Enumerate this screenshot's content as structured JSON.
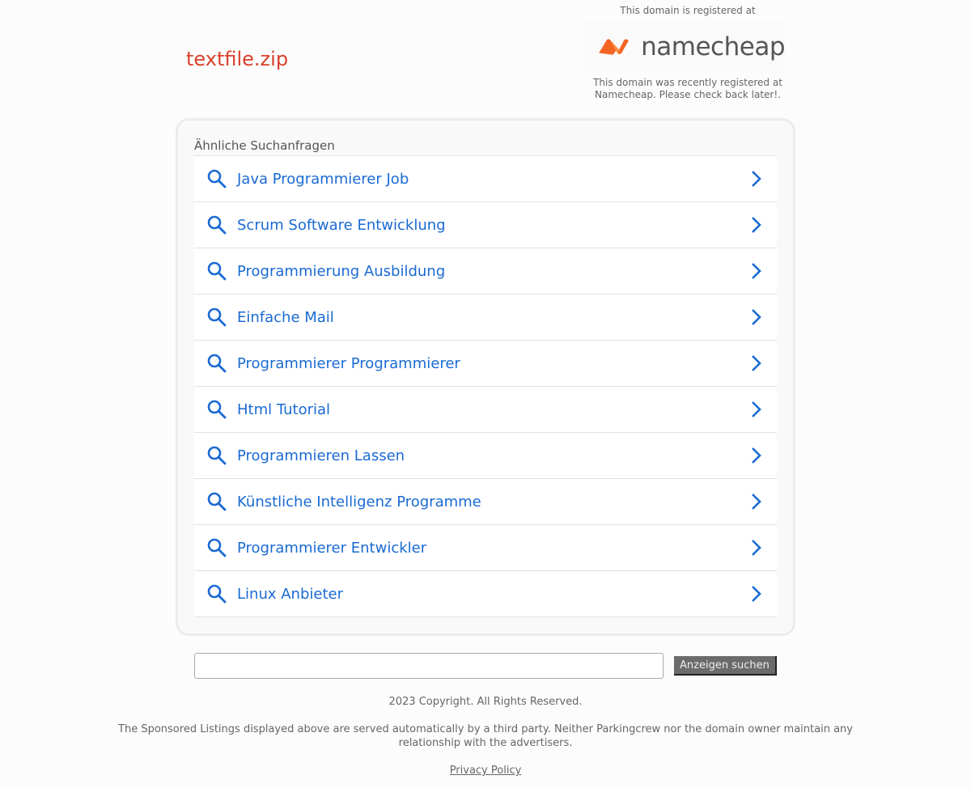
{
  "header": {
    "domain": "textfile.zip",
    "registered_at": "This domain is registered at",
    "registrar_logo": "namecheap",
    "registrar_note": "This domain was recently registered at Namecheap. Please check back later!."
  },
  "related": {
    "heading": "Ähnliche Suchanfragen",
    "items": [
      {
        "label": "Java Programmierer Job"
      },
      {
        "label": "Scrum Software Entwicklung"
      },
      {
        "label": "Programmierung Ausbildung"
      },
      {
        "label": "Einfache Mail"
      },
      {
        "label": "Programmierer Programmierer"
      },
      {
        "label": "Html Tutorial"
      },
      {
        "label": "Programmieren Lassen"
      },
      {
        "label": "Künstliche Intelligenz Programme"
      },
      {
        "label": "Programmierer Entwickler"
      },
      {
        "label": "Linux Anbieter"
      }
    ]
  },
  "search": {
    "value": "",
    "button": "Anzeigen suchen"
  },
  "footer": {
    "copyright": "2023 Copyright. All Rights Reserved.",
    "disclaimer": "The Sponsored Listings displayed above are served automatically by a third party. Neither Parkingcrew nor the domain owner maintain any relationship with the advertisers.",
    "privacy": "Privacy Policy"
  },
  "colors": {
    "link": "#1a6ad3",
    "title": "#d9412b",
    "brand": "#f26522"
  }
}
